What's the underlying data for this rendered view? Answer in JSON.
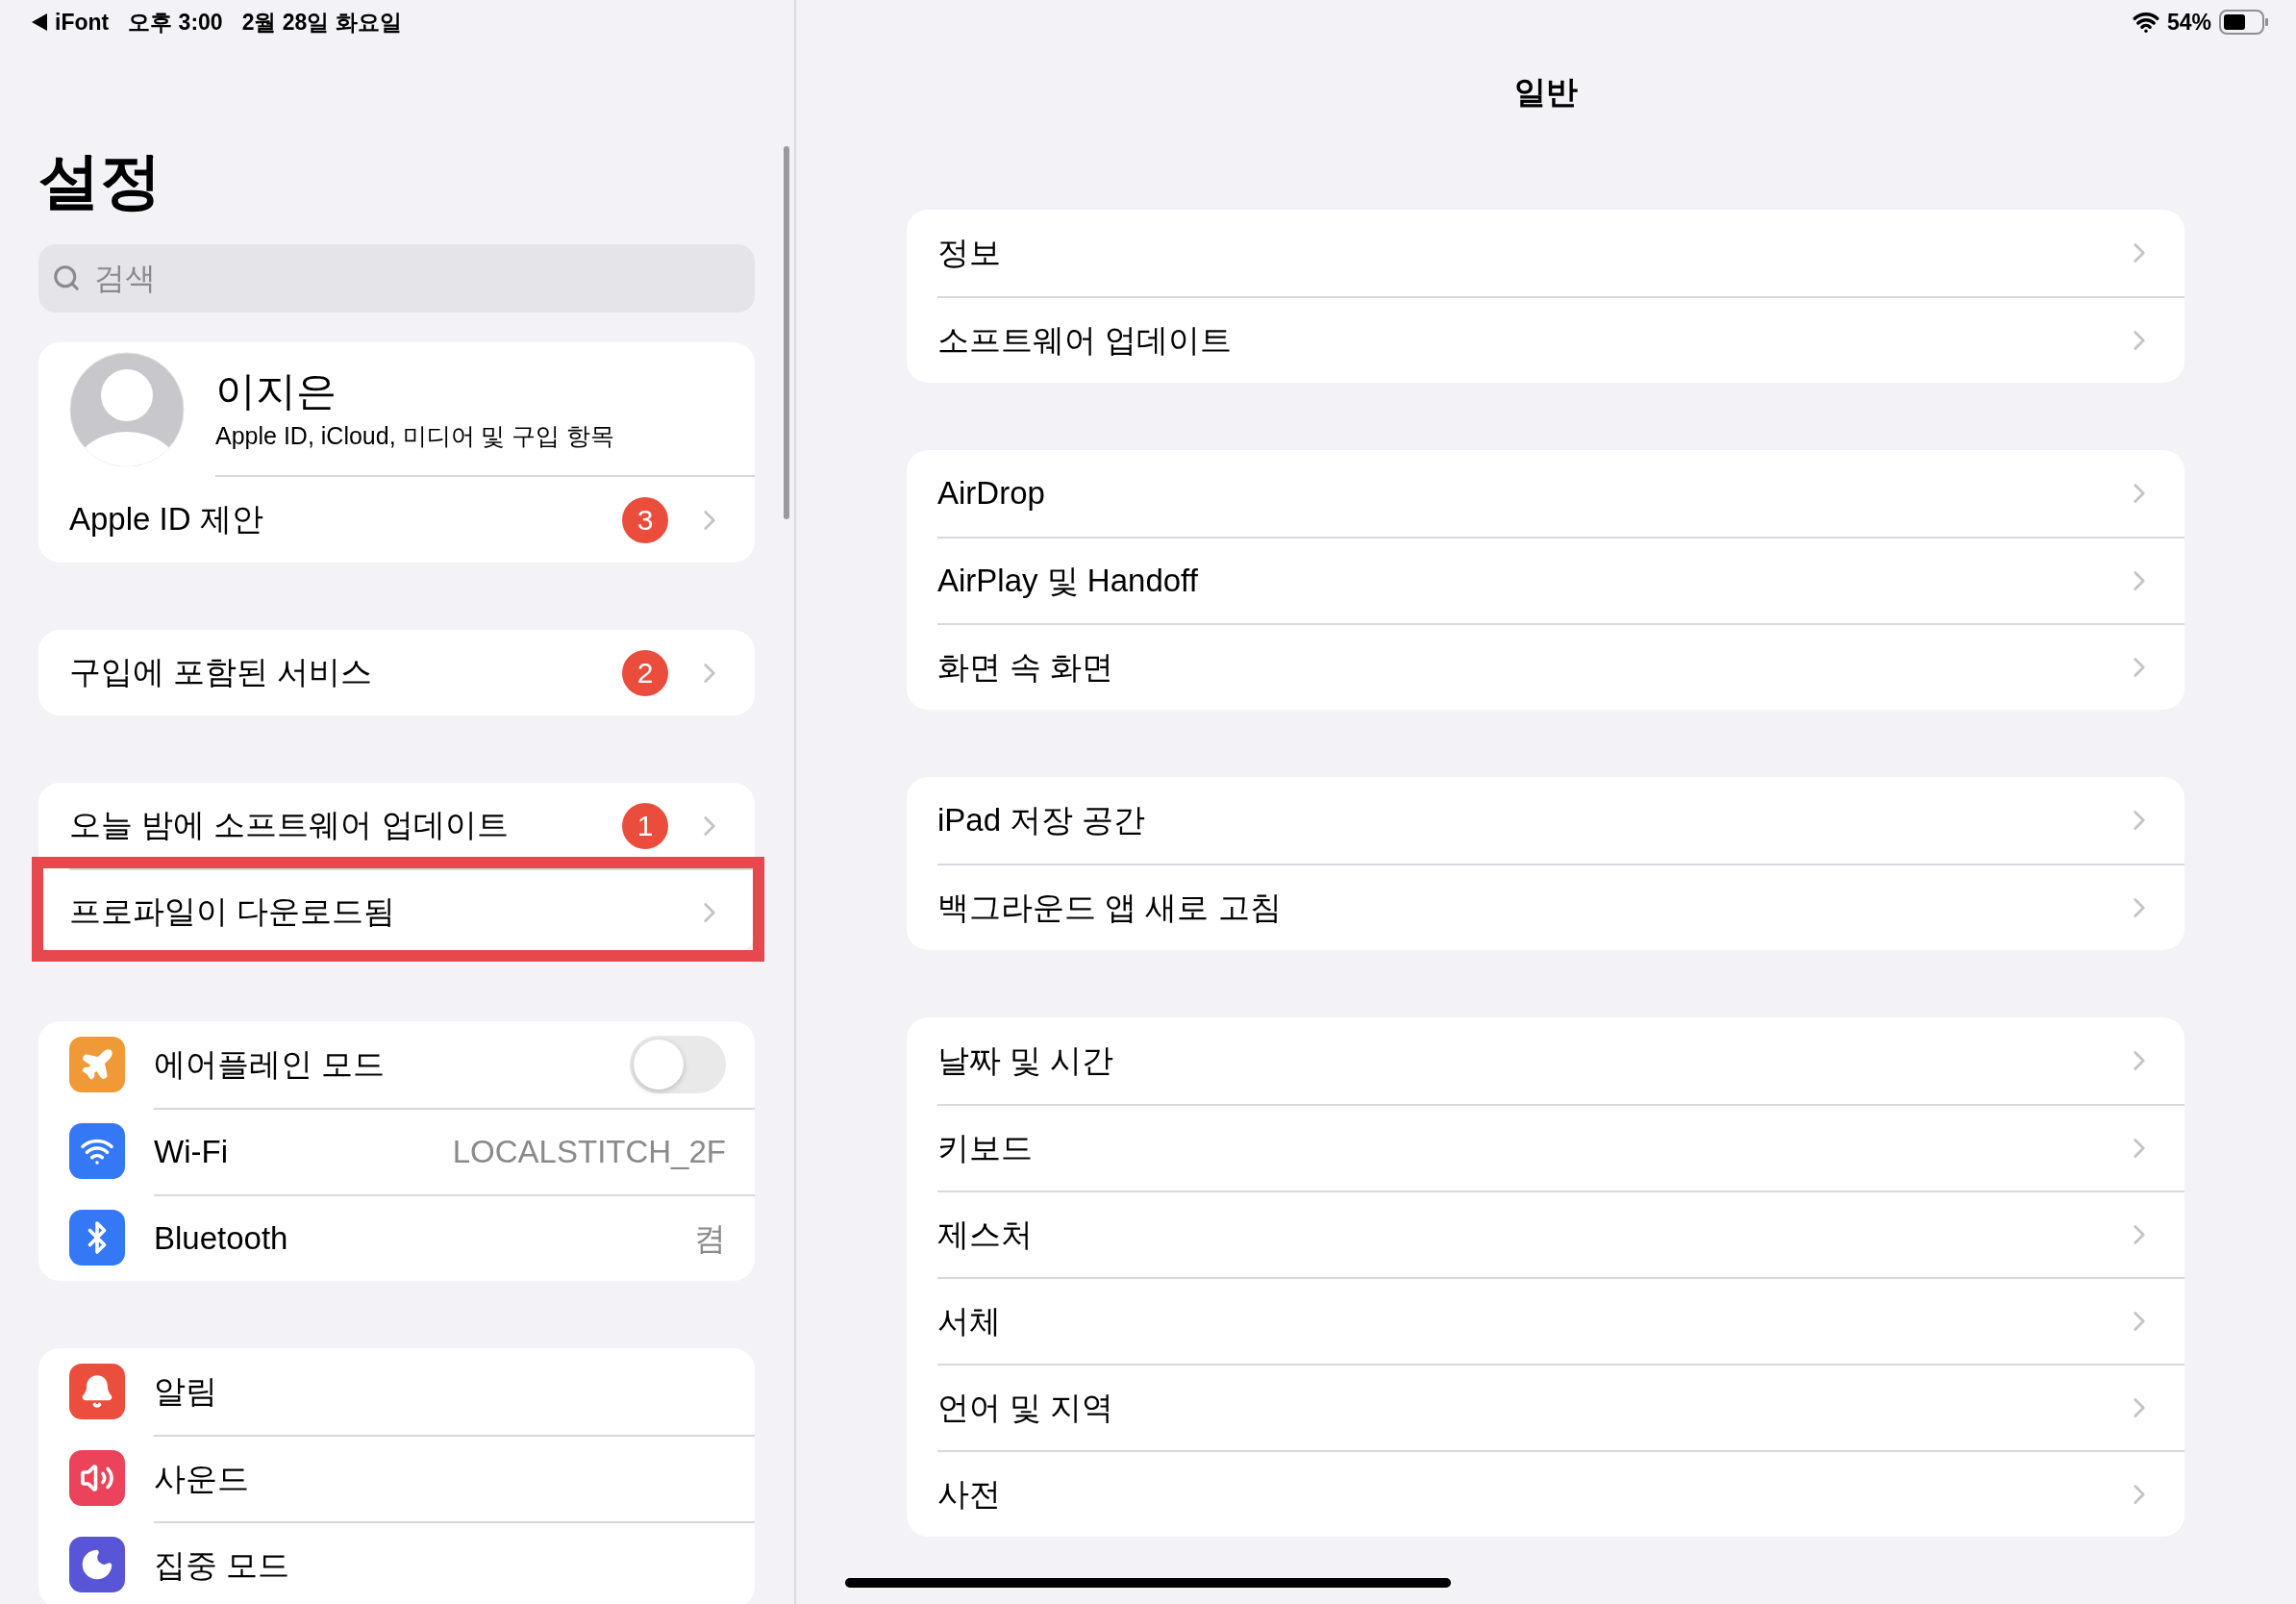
{
  "status_bar": {
    "back_app": "iFont",
    "time": "오후 3:00",
    "date": "2월 28일 화요일",
    "battery": "54%"
  },
  "sidebar": {
    "title": "설정",
    "search": {
      "placeholder": "검색"
    },
    "profile": {
      "name": "이지은",
      "subtitle": "Apple ID, iCloud, 미디어 및 구입 항목"
    },
    "groups": [
      {
        "items": [
          {
            "kind": "link",
            "label": "Apple ID 제안",
            "badge": "3",
            "highlighted": false
          }
        ]
      },
      {
        "items": [
          {
            "kind": "link",
            "label": "구입에 포함된 서비스",
            "badge": "2",
            "highlighted": false
          }
        ]
      },
      {
        "items": [
          {
            "kind": "link",
            "label": "오늘 밤에 소프트웨어 업데이트",
            "badge": "1",
            "highlighted": false
          },
          {
            "kind": "link",
            "label": "프로파일이 다운로드됨",
            "highlighted": true
          }
        ]
      },
      {
        "items": [
          {
            "kind": "toggle",
            "label": "에어플레인 모드",
            "color": "#f09a37",
            "on": false,
            "highlighted": false
          },
          {
            "kind": "value",
            "label": "Wi-Fi",
            "color": "#3478f6",
            "value": "LOCALSTITCH_2F",
            "highlighted": false
          },
          {
            "kind": "value",
            "label": "Bluetooth",
            "color": "#3478f6",
            "value": "켬",
            "highlighted": false
          }
        ]
      },
      {
        "items": [
          {
            "kind": "plain",
            "label": "알림",
            "color": "#eb4e3d",
            "highlighted": false
          },
          {
            "kind": "plain",
            "label": "사운드",
            "color": "#eb445a",
            "highlighted": false
          },
          {
            "kind": "plain",
            "label": "집중 모드",
            "color": "#5856d6",
            "highlighted": false
          }
        ]
      }
    ]
  },
  "detail": {
    "title": "일반",
    "groups": [
      {
        "items": [
          {
            "label": "정보"
          },
          {
            "label": "소프트웨어 업데이트"
          }
        ]
      },
      {
        "items": [
          {
            "label": "AirDrop"
          },
          {
            "label": "AirPlay 및 Handoff"
          },
          {
            "label": "화면 속 화면"
          }
        ]
      },
      {
        "items": [
          {
            "label": "iPad 저장 공간"
          },
          {
            "label": "백그라운드 앱 새로 고침"
          }
        ]
      },
      {
        "items": [
          {
            "label": "날짜 및 시간"
          },
          {
            "label": "키보드"
          },
          {
            "label": "제스처"
          },
          {
            "label": "서체"
          },
          {
            "label": "언어 및 지역"
          },
          {
            "label": "사전"
          }
        ]
      }
    ]
  }
}
